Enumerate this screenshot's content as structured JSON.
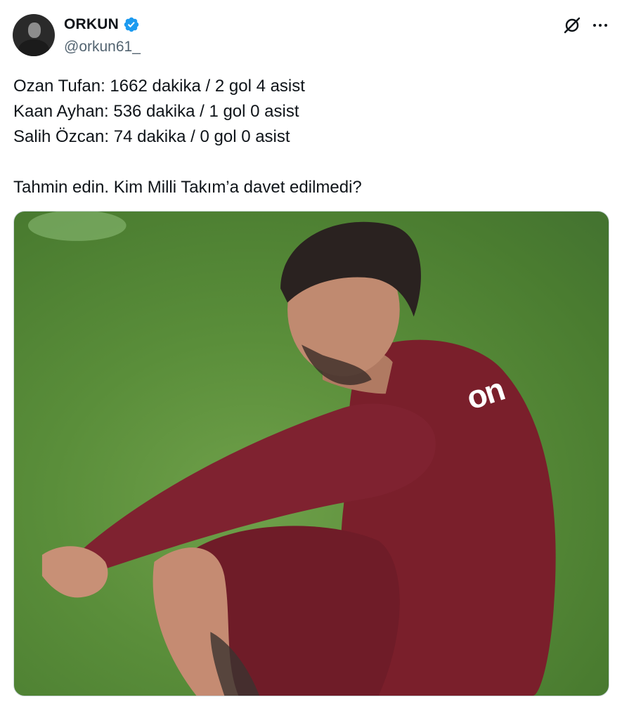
{
  "author": {
    "display_name": "ORKUN",
    "handle": "@orkun61_",
    "verified": true
  },
  "tweet": {
    "lines": [
      "Ozan Tufan: 1662 dakika / 2 gol 4 asist",
      "Kaan Ayhan: 536 dakika / 1 gol 0 asist",
      "Salih Özcan: 74 dakika / 0 gol 0 asist",
      "Tahmin edin. Kim Milli Takım’a davet edilmedi?"
    ]
  },
  "media": {
    "jersey_text": "on"
  },
  "icons": {
    "verified": "verified-badge-icon",
    "grok": "grok-icon",
    "more": "more-icon"
  },
  "colors": {
    "verified": "#1d9bf0",
    "text": "#0f1419",
    "secondary": "#536471"
  }
}
